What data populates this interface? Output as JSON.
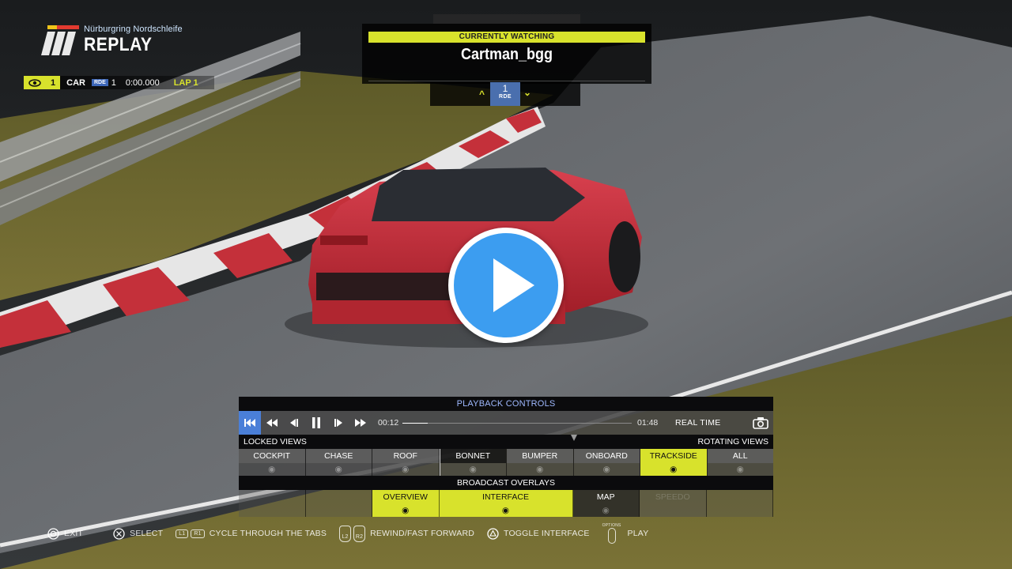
{
  "header": {
    "track": "Nürburgring Nordschleife",
    "mode": "REPLAY"
  },
  "car_bar": {
    "position": "1",
    "car_label": "CAR",
    "car_tag": "RDE",
    "car_number": "1",
    "time": "0:00.000",
    "lap": "LAP 1"
  },
  "watching": {
    "heading": "CURRENTLY WATCHING",
    "driver": "Cartman_bgg",
    "car_number": "1",
    "car_tag": "RDE"
  },
  "playback": {
    "title": "PLAYBACK CONTROLS",
    "current_time": "00:12",
    "end_time": "01:48",
    "progress": 0.11,
    "speed": "REAL TIME"
  },
  "views": {
    "locked_label": "LOCKED VIEWS",
    "rotating_label": "ROTATING VIEWS",
    "items": [
      {
        "label": "COCKPIT"
      },
      {
        "label": "CHASE"
      },
      {
        "label": "ROOF"
      },
      {
        "label": "BONNET"
      },
      {
        "label": "BUMPER"
      },
      {
        "label": "ONBOARD"
      },
      {
        "label": "TRACKSIDE"
      },
      {
        "label": "ALL"
      }
    ],
    "selected": "TRACKSIDE"
  },
  "overlays": {
    "title": "BROADCAST OVERLAYS",
    "overview": "OVERVIEW",
    "interface": "INTERFACE",
    "map": "MAP",
    "disabled": "SPEEDO"
  },
  "hints": {
    "exit": "EXIT",
    "select": "SELECT",
    "l1": "L1",
    "r1": "R1",
    "cycle": "CYCLE THROUGH THE TABS",
    "l2": "L2",
    "r2": "R2",
    "rewind": "REWIND/FAST FORWARD",
    "toggle": "TOGGLE INTERFACE",
    "options": "OPTIONS",
    "play": "PLAY"
  },
  "colors": {
    "accent": "#d8e22c",
    "play_button": "#3c9df0",
    "active_control": "#4a7fd8",
    "car_tag": "#3d67b8"
  }
}
